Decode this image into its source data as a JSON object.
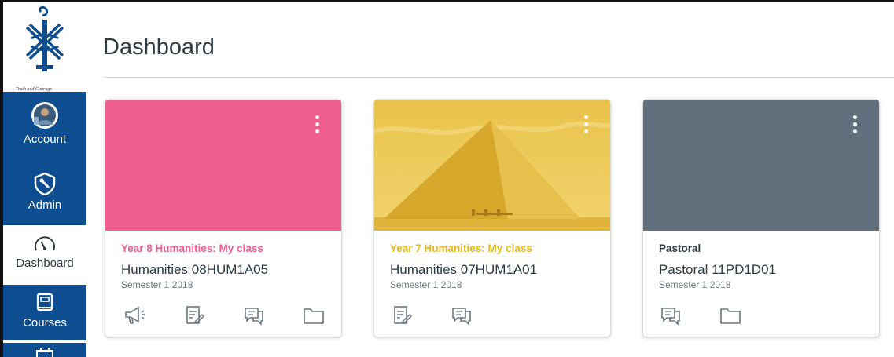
{
  "page": {
    "title": "Dashboard"
  },
  "logo": {
    "motto": "Truth and Courage",
    "icon": "school-crest-icon"
  },
  "global_nav": {
    "items": [
      {
        "label": "Account",
        "icon": "avatar"
      },
      {
        "label": "Admin",
        "icon": "shield-icon"
      },
      {
        "label": "Dashboard",
        "icon": "speedometer-icon"
      },
      {
        "label": "Courses",
        "icon": "book-icon"
      },
      {
        "label": "",
        "icon": "calendar-icon"
      }
    ]
  },
  "cards": [
    {
      "subtitle": "Year 8 Humanities: My class",
      "title": "Humanities 08HUM1A05",
      "term": "Semester 1 2018",
      "color": "#ef5f8e",
      "icons": [
        "announcements-icon",
        "assignments-icon",
        "discussions-icon",
        "files-icon"
      ]
    },
    {
      "subtitle": "Year 7 Humanities: My class",
      "title": "Humanities 07HUM1A01",
      "term": "Semester 1 2018",
      "color": "#efc42b",
      "image": "pyramid-photo",
      "icons": [
        "assignments-icon",
        "discussions-icon"
      ]
    },
    {
      "subtitle": "Pastoral",
      "title": "Pastoral 11PD1D01",
      "term": "Semester 1 2018",
      "color": "#626f7d",
      "icons": [
        "discussions-icon",
        "files-icon"
      ]
    }
  ],
  "colors": {
    "nav_blue": "#0e4d8f",
    "text": "#2d3b45",
    "subtext": "#6b7780",
    "card2_text": "#e8b71a"
  }
}
